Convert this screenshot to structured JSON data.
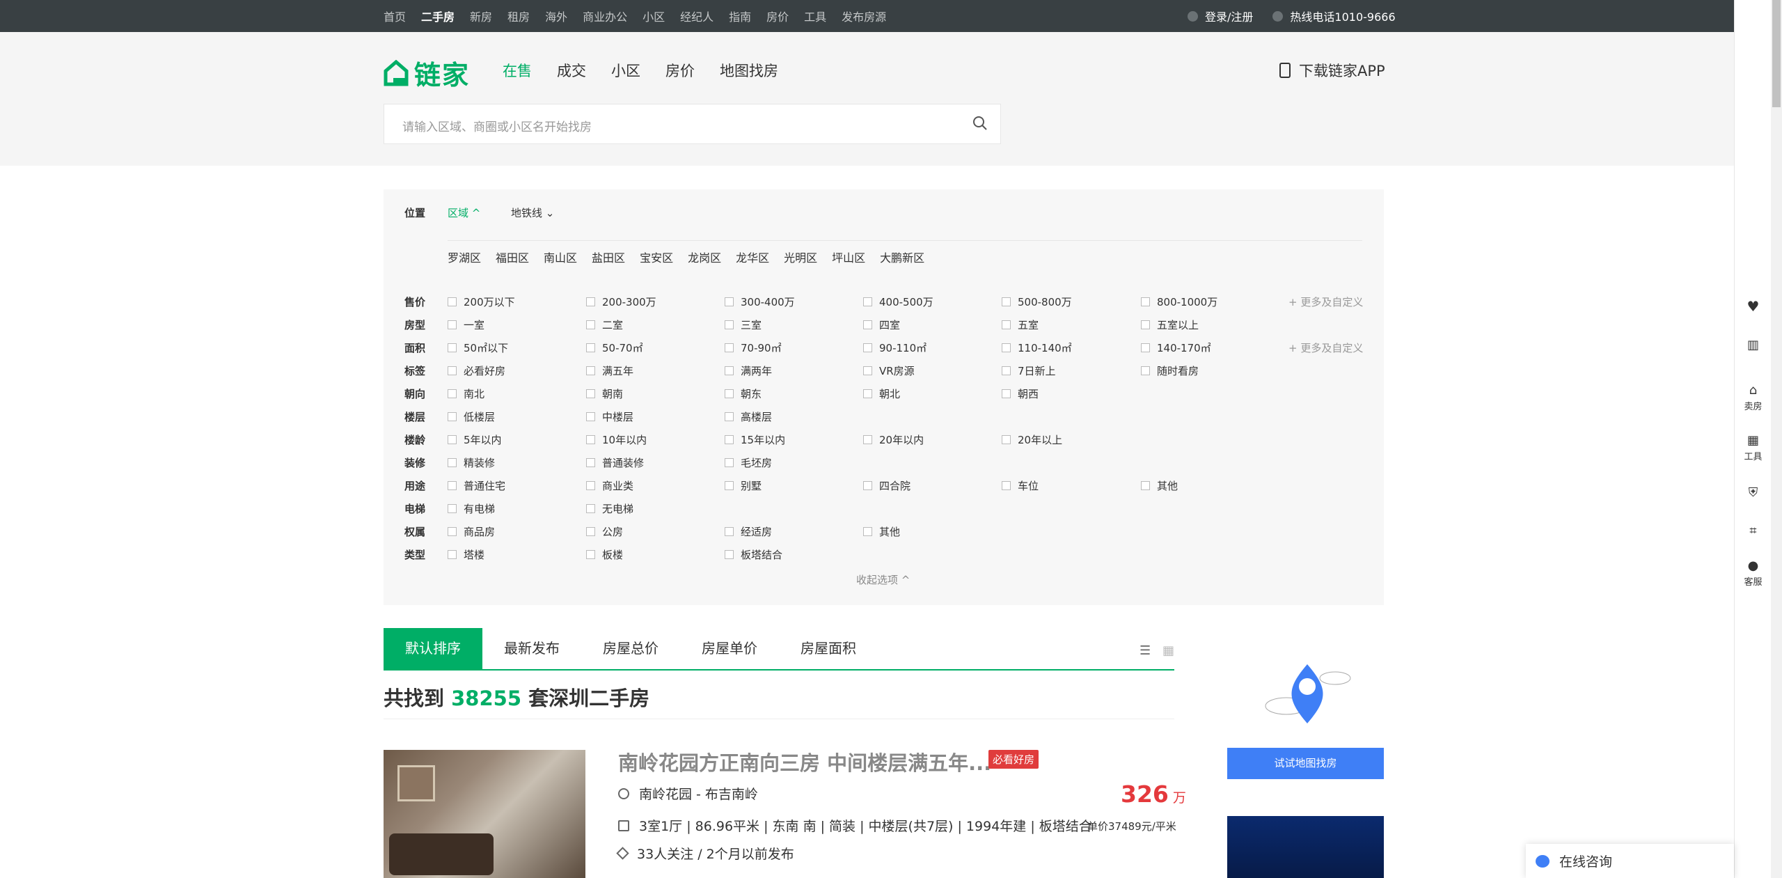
{
  "topnav": {
    "items": [
      "首页",
      "二手房",
      "新房",
      "租房",
      "海外",
      "商业办公",
      "小区",
      "经纪人",
      "指南",
      "房价",
      "工具",
      "发布房源"
    ],
    "active_index": 1,
    "login": "登录/注册",
    "hotline": "热线电话1010-9666"
  },
  "logo_text": "链家",
  "mainnav": [
    "在售",
    "成交",
    "小区",
    "房价",
    "地图找房"
  ],
  "app_download": "下载链家APP",
  "search": {
    "placeholder": "请输入区域、商圈或小区名开始找房"
  },
  "filter": {
    "location_label": "位置",
    "tab_region": "区域",
    "tab_subway": "地铁线",
    "districts": [
      "罗湖区",
      "福田区",
      "南山区",
      "盐田区",
      "宝安区",
      "龙岗区",
      "龙华区",
      "光明区",
      "坪山区",
      "大鹏新区"
    ],
    "rows": [
      {
        "label": "售价",
        "options": [
          "200万以下",
          "200-300万",
          "300-400万",
          "400-500万",
          "500-800万",
          "800-1000万"
        ],
        "more": "+ 更多及自定义"
      },
      {
        "label": "房型",
        "options": [
          "一室",
          "二室",
          "三室",
          "四室",
          "五室",
          "五室以上"
        ]
      },
      {
        "label": "面积",
        "options": [
          "50㎡以下",
          "50-70㎡",
          "70-90㎡",
          "90-110㎡",
          "110-140㎡",
          "140-170㎡"
        ],
        "more": "+ 更多及自定义"
      },
      {
        "label": "标签",
        "options": [
          "必看好房",
          "满五年",
          "满两年",
          "VR房源",
          "7日新上",
          "随时看房"
        ]
      },
      {
        "label": "朝向",
        "options": [
          "南北",
          "朝南",
          "朝东",
          "朝北",
          "朝西"
        ]
      },
      {
        "label": "楼层",
        "options": [
          "低楼层",
          "中楼层",
          "高楼层"
        ]
      },
      {
        "label": "楼龄",
        "options": [
          "5年以内",
          "10年以内",
          "15年以内",
          "20年以内",
          "20年以上"
        ]
      },
      {
        "label": "装修",
        "options": [
          "精装修",
          "普通装修",
          "毛坯房"
        ]
      },
      {
        "label": "用途",
        "options": [
          "普通住宅",
          "商业类",
          "别墅",
          "四合院",
          "车位",
          "其他"
        ]
      },
      {
        "label": "电梯",
        "options": [
          "有电梯",
          "无电梯"
        ]
      },
      {
        "label": "权属",
        "options": [
          "商品房",
          "公房",
          "经适房",
          "其他"
        ]
      },
      {
        "label": "类型",
        "options": [
          "塔楼",
          "板楼",
          "板塔结合"
        ]
      }
    ],
    "collapse": "收起选项 ^"
  },
  "sort_tabs": [
    "默认排序",
    "最新发布",
    "房屋总价",
    "房屋单价",
    "房屋面积"
  ],
  "result": {
    "prefix": "共找到 ",
    "count": "38255",
    "suffix": " 套深圳二手房"
  },
  "listing": {
    "title": "南岭花园方正南向三房 中间楼层满五年...",
    "badge": "必看好房",
    "community": "南岭花园 - 布吉南岭",
    "details": "3室1厅 | 86.96平米 | 东南 南 | 简装 | 中楼层(共7层) | 1994年建 | 板塔结合",
    "followers": "33人关注 / 2个月以前发布",
    "price": "326",
    "price_unit": "万",
    "unit_price": "单价37489元/平米"
  },
  "map_button": "试试地图找房",
  "sidebar": [
    "卖房",
    "工具",
    "客服"
  ],
  "consult": "在线咨询"
}
